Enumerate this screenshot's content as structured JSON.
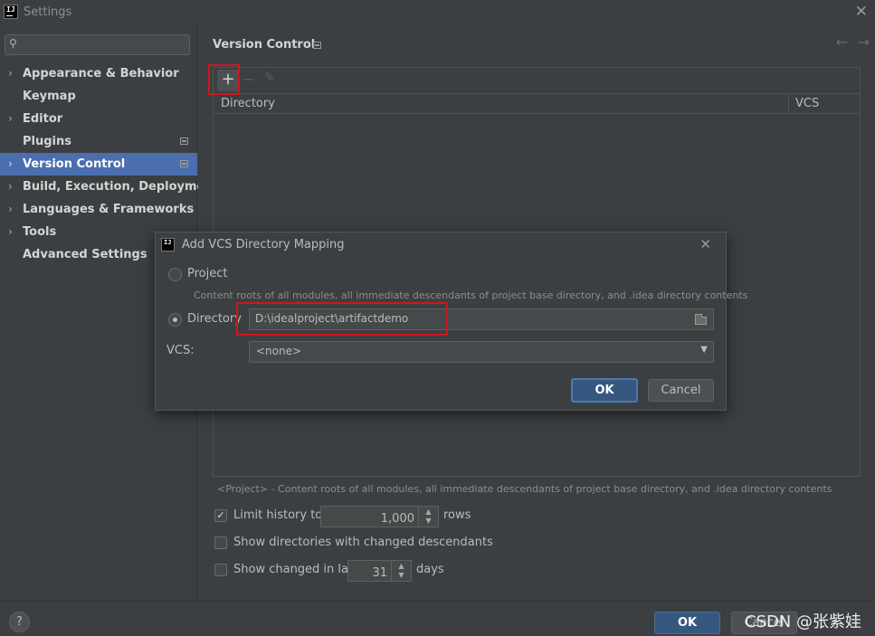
{
  "window": {
    "title": "Settings"
  },
  "sidebar": {
    "items": [
      {
        "label": "Appearance & Behavior",
        "expandable": true
      },
      {
        "label": "Keymap",
        "expandable": false
      },
      {
        "label": "Editor",
        "expandable": true
      },
      {
        "label": "Plugins",
        "expandable": false,
        "project_icon": true
      },
      {
        "label": "Version Control",
        "expandable": true,
        "selected": true,
        "project_icon": true
      },
      {
        "label": "Build, Execution, Deployment",
        "expandable": true
      },
      {
        "label": "Languages & Frameworks",
        "expandable": true
      },
      {
        "label": "Tools",
        "expandable": true
      },
      {
        "label": "Advanced Settings",
        "expandable": false
      }
    ]
  },
  "page": {
    "title": "Version Control",
    "table": {
      "columns": [
        "Directory",
        "VCS"
      ]
    },
    "hint": "<Project> - Content roots of all modules, all immediate descendants of project base directory, and .idea directory contents",
    "limit_history": {
      "label": "Limit history to:",
      "checked": true,
      "value": "1,000",
      "suffix": "rows"
    },
    "show_dirs": {
      "label": "Show directories with changed descendants",
      "checked": false
    },
    "show_changed": {
      "label": "Show changed in last",
      "checked": false,
      "value": "31",
      "suffix": "days"
    }
  },
  "footer": {
    "ok": "OK",
    "cancel": "Cancel",
    "help": "?"
  },
  "watermark": "CSDN @张紫娃",
  "dialog": {
    "title": "Add VCS Directory Mapping",
    "project_label": "Project",
    "project_hint": "Content roots of all modules, all immediate descendants of project base directory, and .idea directory contents",
    "directory_label": "Directory",
    "directory_value": "D:\\idealproject\\artifactdemo",
    "selected_option": "Directory",
    "vcs_label": "VCS:",
    "vcs_value": "<none>",
    "ok": "OK",
    "cancel": "Cancel"
  },
  "colors": {
    "accent": "#4b6eaf",
    "primary_button": "#365880",
    "highlight_box": "#d1151f",
    "background": "#3c3f41"
  },
  "icons": {
    "app": "intellij-icon",
    "search": "search-icon",
    "add": "plus-icon",
    "remove": "minus-icon",
    "edit": "pencil-icon",
    "browse": "folder-icon"
  },
  "icon_text": {
    "app": "IJ"
  }
}
